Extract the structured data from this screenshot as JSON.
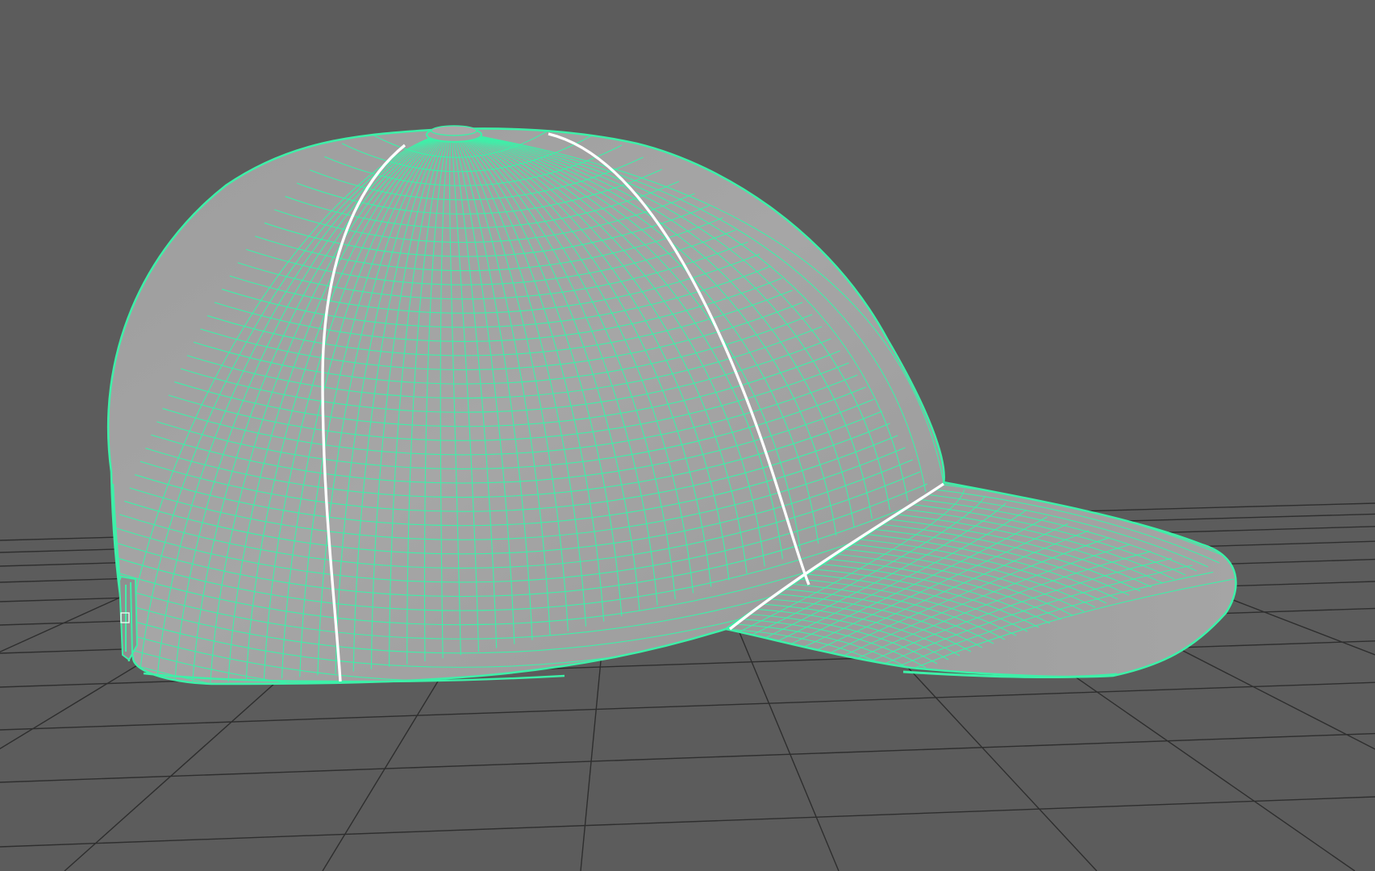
{
  "viewport": {
    "background_color": "#5c5c5c",
    "grid_color": "#2e2e2e",
    "wire_color": "#3df0a8",
    "shade_color": "#a3a3a3",
    "seam_color": "#ffffff"
  },
  "scene": {
    "object": "baseball-cap",
    "display_mode": "wireframe-on-shaded",
    "selected": true
  }
}
